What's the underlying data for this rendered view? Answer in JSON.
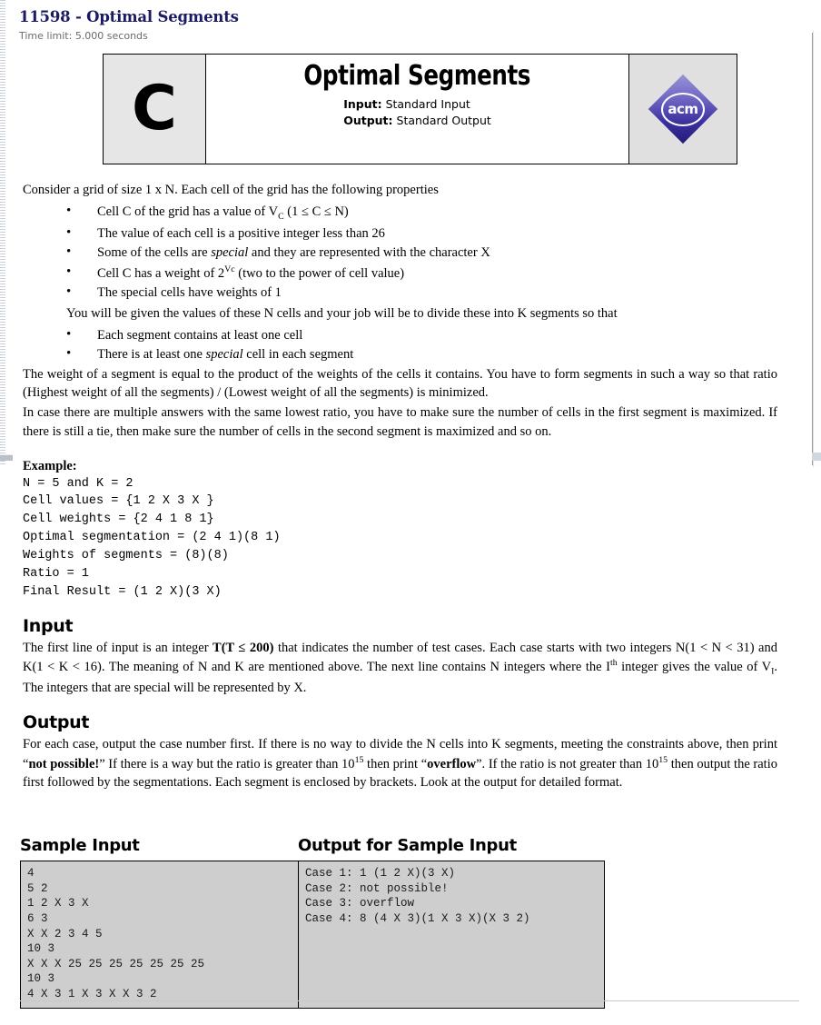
{
  "header": {
    "problem_title": "11598 - Optimal Segments",
    "time_limit": "Time limit: 5.000 seconds"
  },
  "banner": {
    "letter": "C",
    "title": "Optimal Segments",
    "input_label": "Input:",
    "input_value": "Standard Input",
    "output_label": "Output:",
    "output_value": "Standard Output",
    "logo_text": "acm",
    "logo_icon": "acm-diamond-logo-icon",
    "colors": {
      "letter_cell_bg": "#e6e6e6",
      "logo_cell_bg": "#e0e0e0",
      "logo_purple": "#3a2f9e"
    }
  },
  "statement": {
    "intro": "Consider a grid of size 1 x N. Each cell of the grid has the following properties",
    "bullet1_pre": "Cell C of the grid has a value of V",
    "bullet1_sub": "C",
    "bullet1_post": " (1 ≤ C ≤ N)",
    "bullet2": "The value of each cell is a positive integer less than 26",
    "bullet3_a": "Some of the cells are ",
    "bullet3_em": "special",
    "bullet3_b": " and they are represented with the character X",
    "bullet4_pre": "Cell C has a weight of 2",
    "bullet4_sup": "Vc",
    "bullet4_post": " (two to the power of cell value)",
    "bullet5": "The special cells have weights of 1",
    "mid_note": "You will be given the values of these N cells and your job will be to divide these into K segments so that",
    "bullet6": "Each segment contains at least one cell",
    "bullet7_a": "There is at least one ",
    "bullet7_em": "special",
    "bullet7_b": " cell in each segment",
    "para_weight": "The weight of a segment is equal to the product of the weights of the cells it contains. You have to form segments in such a way so that ratio (Highest weight of all the segments) / (Lowest weight of all the segments) is minimized.",
    "para_tie": "In case there are multiple answers with the same lowest ratio, you have to make sure the number of cells in the first segment is maximized. If there is still a tie, then make sure the number of cells in the second segment is maximized and so on."
  },
  "example": {
    "label": "Example:",
    "lines": "N = 5 and K = 2\nCell values = {1 2 X 3 X }\nCell weights = {2 4 1 8 1}\nOptimal segmentation = (2 4 1)(8 1)\nWeights of segments = (8)(8)\nRatio = 1\nFinal Result = (1 2 X)(3 X)"
  },
  "input_section": {
    "heading": "Input",
    "t1": "The first line of input is an integer ",
    "t_bold": "T(T ≤ 200)",
    "t2": " that indicates the number of test cases. Each case starts with two integers N(1 < N < 31) and K(1 < K < 16). The meaning of N and K are mentioned above. The next line contains N integers where the I",
    "t_sup": "th",
    "t3": " integer gives the value of V",
    "t_sub": "I",
    "t4": ". The integers that are special will be represented by X."
  },
  "output_section": {
    "heading": "Output",
    "o1": "For each case, output the case number first. If there is no way to divide the N cells into K segments, meeting the constraints above, then print “",
    "o_bold1": "not possible!",
    "o2": "” If there is a way but the ratio is greater than 10",
    "o_sup1": "15",
    "o3": " then print “",
    "o_bold2": "overflow",
    "o4": "”. If the ratio is not greater than 10",
    "o_sup2": "15",
    "o5": " then output the ratio first followed by the segmentations. Each segment is enclosed by brackets. Look at the output for detailed format."
  },
  "samples": {
    "input_heading": "Sample Input",
    "output_heading": "Output for Sample Input",
    "input_text": "4\n5 2\n1 2 X 3 X\n6 3\nX X 2 3 4 5\n10 3\nX X X 25 25 25 25 25 25 25\n10 3\n4 X 3 1 X 3 X X 3 2",
    "output_text": "Case 1: 1 (1 2 X)(3 X)\nCase 2: not possible!\nCase 3: overflow\nCase 4: 8 (4 X 3)(1 X 3 X)(X 3 2)",
    "box_bg": "#cecece"
  }
}
